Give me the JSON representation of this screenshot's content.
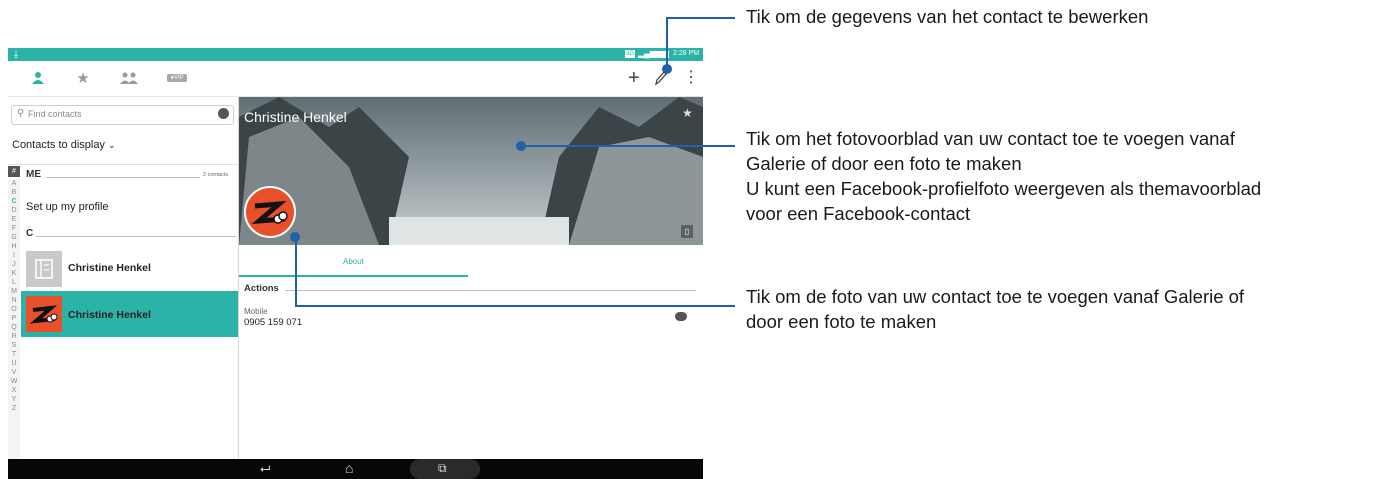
{
  "statusbar": {
    "time": "2:28 PM",
    "sim": "3G"
  },
  "topbar": {
    "tabs": [
      "contacts-icon",
      "favorites-icon",
      "groups-icon",
      "vip-tab"
    ],
    "vip_label": "VIP",
    "actions": [
      "add-icon",
      "edit-icon",
      "more-icon"
    ]
  },
  "leftpane": {
    "search_placeholder": "Find contacts",
    "contacts_to_display": "Contacts to display",
    "me_header": "ME",
    "me_count": "2 contacts",
    "setup_profile": "Set up my profile",
    "c_header": "C",
    "contacts": [
      {
        "name": "Christine Henkel",
        "selected": false
      },
      {
        "name": "Christine Henkel",
        "selected": true
      }
    ],
    "alphabet": [
      "#",
      "A",
      "B",
      "C",
      "D",
      "E",
      "F",
      "G",
      "H",
      "I",
      "J",
      "K",
      "L",
      "M",
      "N",
      "O",
      "P",
      "Q",
      "R",
      "S",
      "T",
      "U",
      "V",
      "W",
      "X",
      "Y",
      "Z"
    ]
  },
  "detail": {
    "name": "Christine Henkel",
    "tab_about": "About",
    "actions_header": "Actions",
    "phone_type": "Mobile",
    "phone_number": "0905 159 071"
  },
  "callouts": {
    "edit_line1": "Tik om de gegevens van het contact te bewerken",
    "cover_line1": "Tik om het fotovoorblad van uw contact toe te voegen vanaf",
    "cover_line2": "Galerie of door een foto te maken",
    "cover_line3": "U kunt een Facebook-profielfoto weergeven als themavoorblad",
    "cover_line4": "voor een Facebook-contact",
    "photo_line1": "Tik om de foto van uw contact toe te voegen vanaf Galerie of",
    "photo_line2": "door een foto te maken"
  },
  "colors": {
    "accent": "#2bb3a8",
    "callout_line": "#1f62a8",
    "avatar": "#e8502b",
    "navbar": "#070707"
  }
}
